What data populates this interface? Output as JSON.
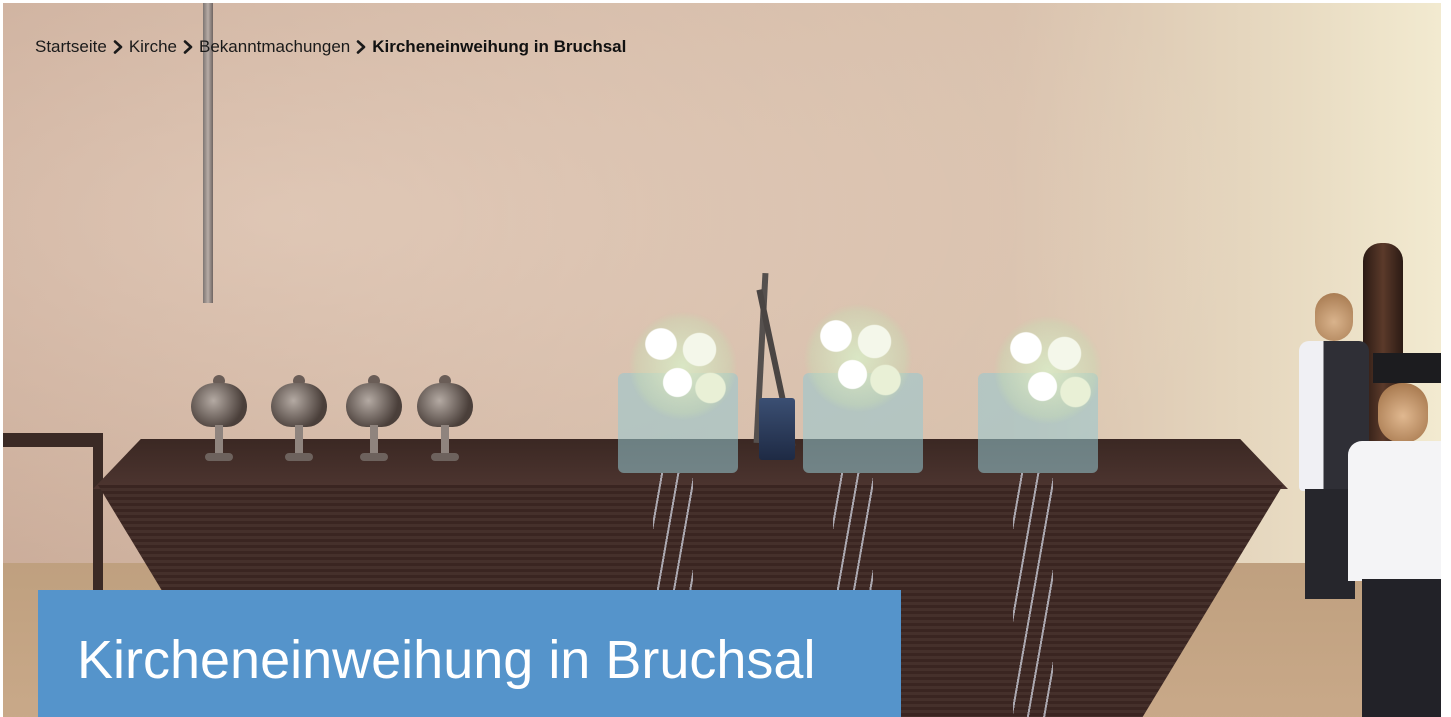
{
  "breadcrumb": {
    "items": [
      {
        "label": "Startseite"
      },
      {
        "label": "Kirche"
      },
      {
        "label": "Bekanntmachungen"
      }
    ],
    "current": "Kircheneinweihung in Bruchsal",
    "separator_icon": "chevron-right-icon"
  },
  "hero": {
    "title": "Kircheneinweihung in Bruchsal"
  },
  "colors": {
    "title_card_background": "#5594cb",
    "title_text": "#ffffff",
    "breadcrumb_text": "#1a1a1a"
  }
}
